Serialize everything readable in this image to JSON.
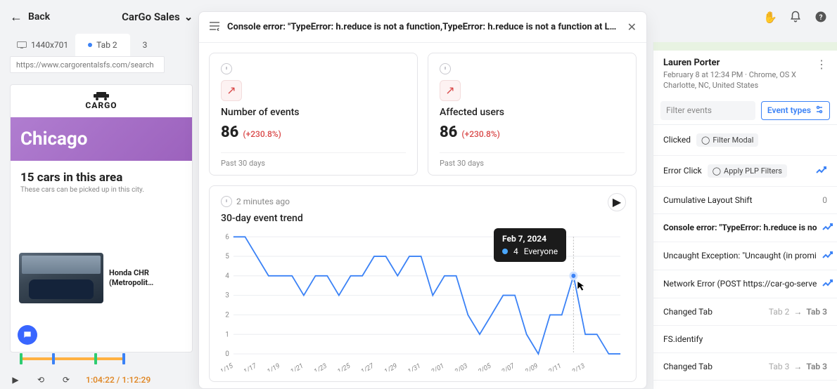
{
  "topbar": {
    "back_label": "Back",
    "app_title": "CarGo Sales"
  },
  "tabstrip": {
    "dimensions": "1440x701",
    "tabs": [
      {
        "label": "Tab 2",
        "active": true
      },
      {
        "label": "3",
        "active": false
      }
    ],
    "url": "https://www.cargorentalsfs.com/search"
  },
  "preview": {
    "logo_text": "CARGO",
    "banner_city": "Chicago",
    "headline": "15 cars in this area",
    "subline": "These cars can be picked up in this city.",
    "car_title": "Honda CHR",
    "car_sub": "(Metropolit…"
  },
  "player": {
    "cur": "1:04:22",
    "dur": "1:12:29"
  },
  "modal": {
    "title": "Console error: \"TypeError: h.reduce is not a function,TypeError: h.reduce is not a function at Ld (http...",
    "metrics": [
      {
        "label": "Number of events",
        "value": "86",
        "delta": "(+230.8%)",
        "period": "Past 30 days"
      },
      {
        "label": "Affected users",
        "value": "86",
        "delta": "(+230.8%)",
        "period": "Past 30 days"
      }
    ],
    "chart_updated": "2 minutes ago",
    "chart_title": "30-day event trend",
    "tooltip": {
      "date": "Feb 7, 2024",
      "value": "4",
      "series": "Everyone"
    }
  },
  "chart_data": {
    "type": "line",
    "title": "30-day event trend",
    "xlabel": "",
    "ylabel": "",
    "ylim": [
      0,
      6
    ],
    "categories": [
      "1/15",
      "1/17",
      "1/19",
      "1/21",
      "1/23",
      "1/25",
      "1/27",
      "1/29",
      "1/31",
      "2/01",
      "2/03",
      "2/05",
      "2/07",
      "2/09",
      "2/11",
      "2/13"
    ],
    "series": [
      {
        "name": "Everyone",
        "values": [
          6,
          6,
          5,
          4,
          4,
          4,
          3,
          4,
          4,
          3,
          4,
          4,
          5,
          5,
          4,
          5,
          5,
          3,
          4,
          4,
          2,
          1,
          2,
          3,
          3,
          1,
          0,
          2,
          2,
          4,
          1,
          1,
          0,
          0
        ]
      }
    ]
  },
  "rightpanel": {
    "user_name": "Lauren Porter",
    "user_meta1": "February 8 at 12:34 PM  ·  Chrome, OS X",
    "user_meta2": "Charlotte, NC, United States",
    "filter_placeholder": "Filter events",
    "event_types_label": "Event types",
    "events": [
      {
        "label": "Clicked",
        "chip": "Filter Modal",
        "chip_icon": "target"
      },
      {
        "label": "Error Click",
        "chip": "Apply PLP Filters",
        "chip_icon": "target",
        "trend": true
      },
      {
        "label": "Cumulative Layout Shift",
        "right": "0"
      },
      {
        "label": "Console error: \"TypeError: h.reduce is no",
        "trend": true,
        "selected": true
      },
      {
        "label": "Uncaught Exception: \"Uncaught (in promi",
        "trend": true
      },
      {
        "label": "Network Error (POST https://car-go-serve",
        "trend": true
      },
      {
        "label": "Changed Tab",
        "right_flow": [
          "Tab 2",
          "Tab 3"
        ]
      },
      {
        "label": "FS.identify"
      },
      {
        "label": "Changed Tab",
        "right_flow": [
          "Tab 3",
          "Tab 3"
        ]
      }
    ]
  }
}
